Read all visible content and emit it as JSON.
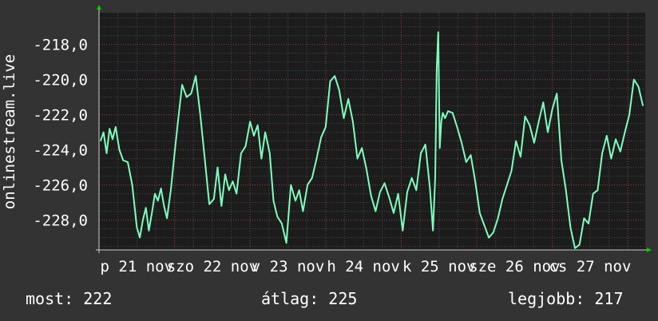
{
  "chart_data": {
    "type": "line",
    "ylabel": "onlinestream.live",
    "ylim": [
      -229.7,
      -216.2
    ],
    "yticks": [
      -228,
      -226,
      -224,
      -222,
      -220,
      -218
    ],
    "ytick_labels": [
      "-228,0",
      "-226,0",
      "-224,0",
      "-222,0",
      "-220,0",
      "-218,0"
    ],
    "xlim": [
      0,
      7.23
    ],
    "xticks": [
      0.5,
      1.5,
      2.5,
      3.5,
      4.5,
      5.5,
      6.5
    ],
    "xtick_labels": [
      "p 21 nov",
      "szo 22 nov",
      "v 23 nov",
      "h 24 nov",
      "k 25 nov",
      "sze 26 nov",
      "cs 27 nov"
    ],
    "grid": true,
    "line_color": "#7fffbf",
    "series": [
      {
        "x": [
          0.02,
          0.06,
          0.1,
          0.14,
          0.18,
          0.22,
          0.27,
          0.32,
          0.38,
          0.44,
          0.5,
          0.54,
          0.58,
          0.62,
          0.66,
          0.7,
          0.74,
          0.78,
          0.82,
          0.86,
          0.9,
          0.95,
          1.0,
          1.05,
          1.1,
          1.16,
          1.22,
          1.28,
          1.34,
          1.4,
          1.46,
          1.52,
          1.57,
          1.62,
          1.67,
          1.72,
          1.77,
          1.82,
          1.88,
          1.94,
          2.0,
          2.05,
          2.1,
          2.15,
          2.2,
          2.26,
          2.31,
          2.36,
          2.42,
          2.48,
          2.54,
          2.6,
          2.65,
          2.7,
          2.76,
          2.82,
          2.88,
          2.94,
          3.0,
          3.06,
          3.12,
          3.18,
          3.24,
          3.3,
          3.36,
          3.42,
          3.48,
          3.54,
          3.6,
          3.66,
          3.72,
          3.78,
          3.84,
          3.9,
          3.96,
          4.02,
          4.08,
          4.14,
          4.2,
          4.26,
          4.32,
          4.38,
          4.42,
          4.45,
          4.47,
          4.49,
          4.51,
          4.53,
          4.55,
          4.58,
          4.62,
          4.68,
          4.74,
          4.8,
          4.86,
          4.92,
          4.98,
          5.04,
          5.1,
          5.16,
          5.22,
          5.28,
          5.34,
          5.4,
          5.46,
          5.52,
          5.58,
          5.64,
          5.7,
          5.76,
          5.82,
          5.88,
          5.94,
          6.0,
          6.06,
          6.12,
          6.18,
          6.24,
          6.3,
          6.36,
          6.42,
          6.48,
          6.54,
          6.6,
          6.66,
          6.72,
          6.78,
          6.84,
          6.9,
          6.96,
          7.02,
          7.08,
          7.14,
          7.2
        ],
        "values": [
          -223.5,
          -223.0,
          -224.2,
          -222.8,
          -223.4,
          -222.7,
          -224.0,
          -224.6,
          -224.7,
          -226.0,
          -228.4,
          -229.0,
          -228.0,
          -227.3,
          -228.6,
          -227.6,
          -226.5,
          -226.9,
          -226.2,
          -227.2,
          -227.9,
          -226.3,
          -224.2,
          -222.2,
          -220.3,
          -221.0,
          -220.8,
          -219.8,
          -222.0,
          -224.5,
          -227.1,
          -226.8,
          -225.0,
          -227.2,
          -225.4,
          -226.3,
          -225.8,
          -226.5,
          -224.2,
          -223.8,
          -222.4,
          -223.2,
          -222.6,
          -224.5,
          -223.0,
          -224.2,
          -226.9,
          -227.8,
          -228.2,
          -229.3,
          -226.0,
          -226.9,
          -226.3,
          -227.5,
          -226.0,
          -225.6,
          -224.5,
          -223.3,
          -222.7,
          -220.1,
          -219.8,
          -220.6,
          -222.2,
          -221.1,
          -222.4,
          -224.5,
          -223.9,
          -225.1,
          -226.6,
          -227.5,
          -226.4,
          -225.9,
          -226.7,
          -227.6,
          -226.5,
          -228.6,
          -226.4,
          -225.6,
          -226.3,
          -224.2,
          -223.7,
          -226.2,
          -228.6,
          -225.6,
          -219.4,
          -217.3,
          -223.9,
          -222.4,
          -221.9,
          -222.2,
          -221.8,
          -221.9,
          -222.7,
          -223.6,
          -224.7,
          -224.3,
          -225.8,
          -227.6,
          -228.3,
          -229.0,
          -228.7,
          -227.9,
          -226.8,
          -226.0,
          -225.2,
          -223.5,
          -224.4,
          -222.1,
          -222.6,
          -223.6,
          -222.4,
          -221.3,
          -223.0,
          -221.7,
          -220.8,
          -224.6,
          -226.3,
          -228.4,
          -229.6,
          -229.4,
          -227.9,
          -228.2,
          -226.5,
          -226.3,
          -224.2,
          -223.2,
          -224.5,
          -223.4,
          -224.1,
          -223.0,
          -222.0,
          -220.0,
          -220.4,
          -221.5
        ]
      }
    ]
  },
  "footer": {
    "current_label": "most:",
    "current_value": "222",
    "average_label": "átlag:",
    "average_value": "225",
    "best_label": "legjobb:",
    "best_value": "217"
  }
}
